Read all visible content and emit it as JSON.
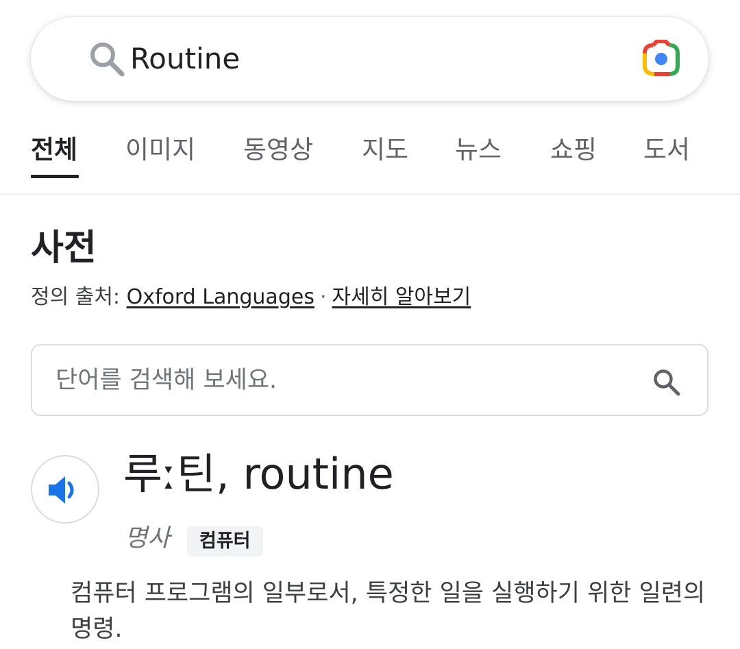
{
  "search": {
    "query": "Routine",
    "search_icon": "search-icon",
    "lens_icon": "google-lens-icon"
  },
  "tabs": [
    {
      "label": "전체",
      "active": true
    },
    {
      "label": "이미지",
      "active": false
    },
    {
      "label": "동영상",
      "active": false
    },
    {
      "label": "지도",
      "active": false
    },
    {
      "label": "뉴스",
      "active": false
    },
    {
      "label": "쇼핑",
      "active": false
    },
    {
      "label": "도서",
      "active": false
    }
  ],
  "dictionary": {
    "title": "사전",
    "source_prefix": "정의 출처:",
    "source_link": "Oxford Languages",
    "separator": "·",
    "learn_more_link": "자세히 알아보기",
    "word_search_placeholder": "단어를 검색해 보세요.",
    "entry": {
      "headword": "루ː틴, routine",
      "speaker_icon": "speaker-icon",
      "part_of_speech": "명사",
      "domain_label": "컴퓨터",
      "definition": "컴퓨터 프로그램의 일부로서, 특정한 일을 실행하기 위한 일련의 명령."
    }
  },
  "colors": {
    "text_primary": "#202124",
    "text_secondary": "#5f6368",
    "speaker_blue": "#1a73e8",
    "lens_blue": "#4285f4",
    "lens_red": "#ea4335",
    "lens_yellow": "#fbbc04",
    "lens_green": "#34a853"
  }
}
